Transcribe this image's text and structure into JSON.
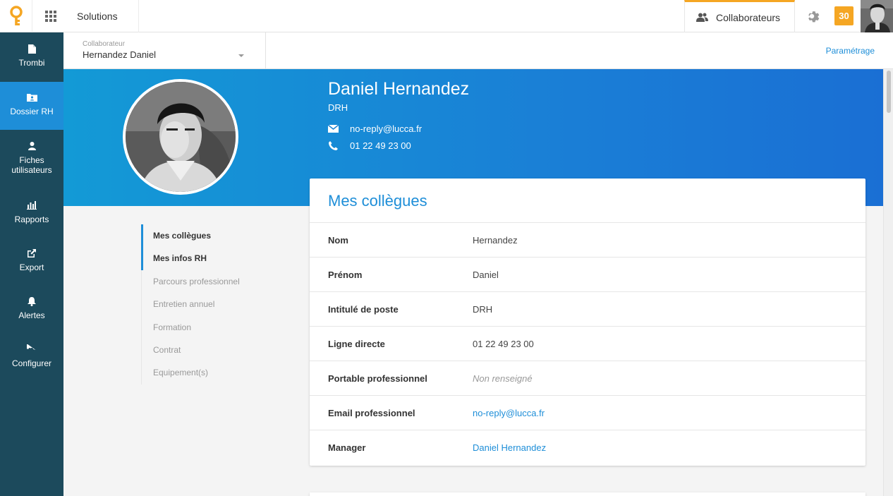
{
  "topbar": {
    "solutions_label": "Solutions",
    "collaborateurs_label": "Collaborateurs",
    "badge_count": "30",
    "accent_color": "#f5a623"
  },
  "sidebar": {
    "items": [
      {
        "label": "Trombi",
        "icon": "file-icon"
      },
      {
        "label": "Dossier RH",
        "icon": "folder-user-icon",
        "active": true
      },
      {
        "label": "Fiches utilisateurs",
        "icon": "user-icon"
      },
      {
        "label": "Rapports",
        "icon": "bar-chart-icon"
      },
      {
        "label": "Export",
        "icon": "external-link-icon"
      },
      {
        "label": "Alertes",
        "icon": "bell-icon"
      },
      {
        "label": "Configurer",
        "icon": "gear-icon"
      }
    ],
    "bg_color": "#1c4a5c",
    "active_color": "#1e8ed8"
  },
  "subheader": {
    "collab_label": "Collaborateur",
    "collab_value": "Hernandez Daniel",
    "parametrage": "Paramétrage"
  },
  "profile": {
    "name": "Daniel Hernandez",
    "title": "DRH",
    "email": "no-reply@lucca.fr",
    "phone": "01 22 49 23 00"
  },
  "section_nav": [
    {
      "label": "Mes collègues",
      "state": "active"
    },
    {
      "label": "Mes infos RH",
      "state": "active"
    },
    {
      "label": "Parcours professionnel",
      "state": "inactive"
    },
    {
      "label": "Entretien annuel",
      "state": "inactive"
    },
    {
      "label": "Formation",
      "state": "inactive"
    },
    {
      "label": "Contrat",
      "state": "inactive"
    },
    {
      "label": "Equipement(s)",
      "state": "inactive"
    }
  ],
  "card": {
    "title": "Mes collègues",
    "rows": [
      {
        "key": "Nom",
        "value": "Hernandez"
      },
      {
        "key": "Prénom",
        "value": "Daniel"
      },
      {
        "key": "Intitulé de poste",
        "value": "DRH"
      },
      {
        "key": "Ligne directe",
        "value": "01 22 49 23 00"
      },
      {
        "key": "Portable professionnel",
        "value": "Non renseigné"
      },
      {
        "key": "Email professionnel",
        "value": "no-reply@lucca.fr"
      },
      {
        "key": "Manager",
        "value": "Daniel Hernandez"
      }
    ]
  }
}
